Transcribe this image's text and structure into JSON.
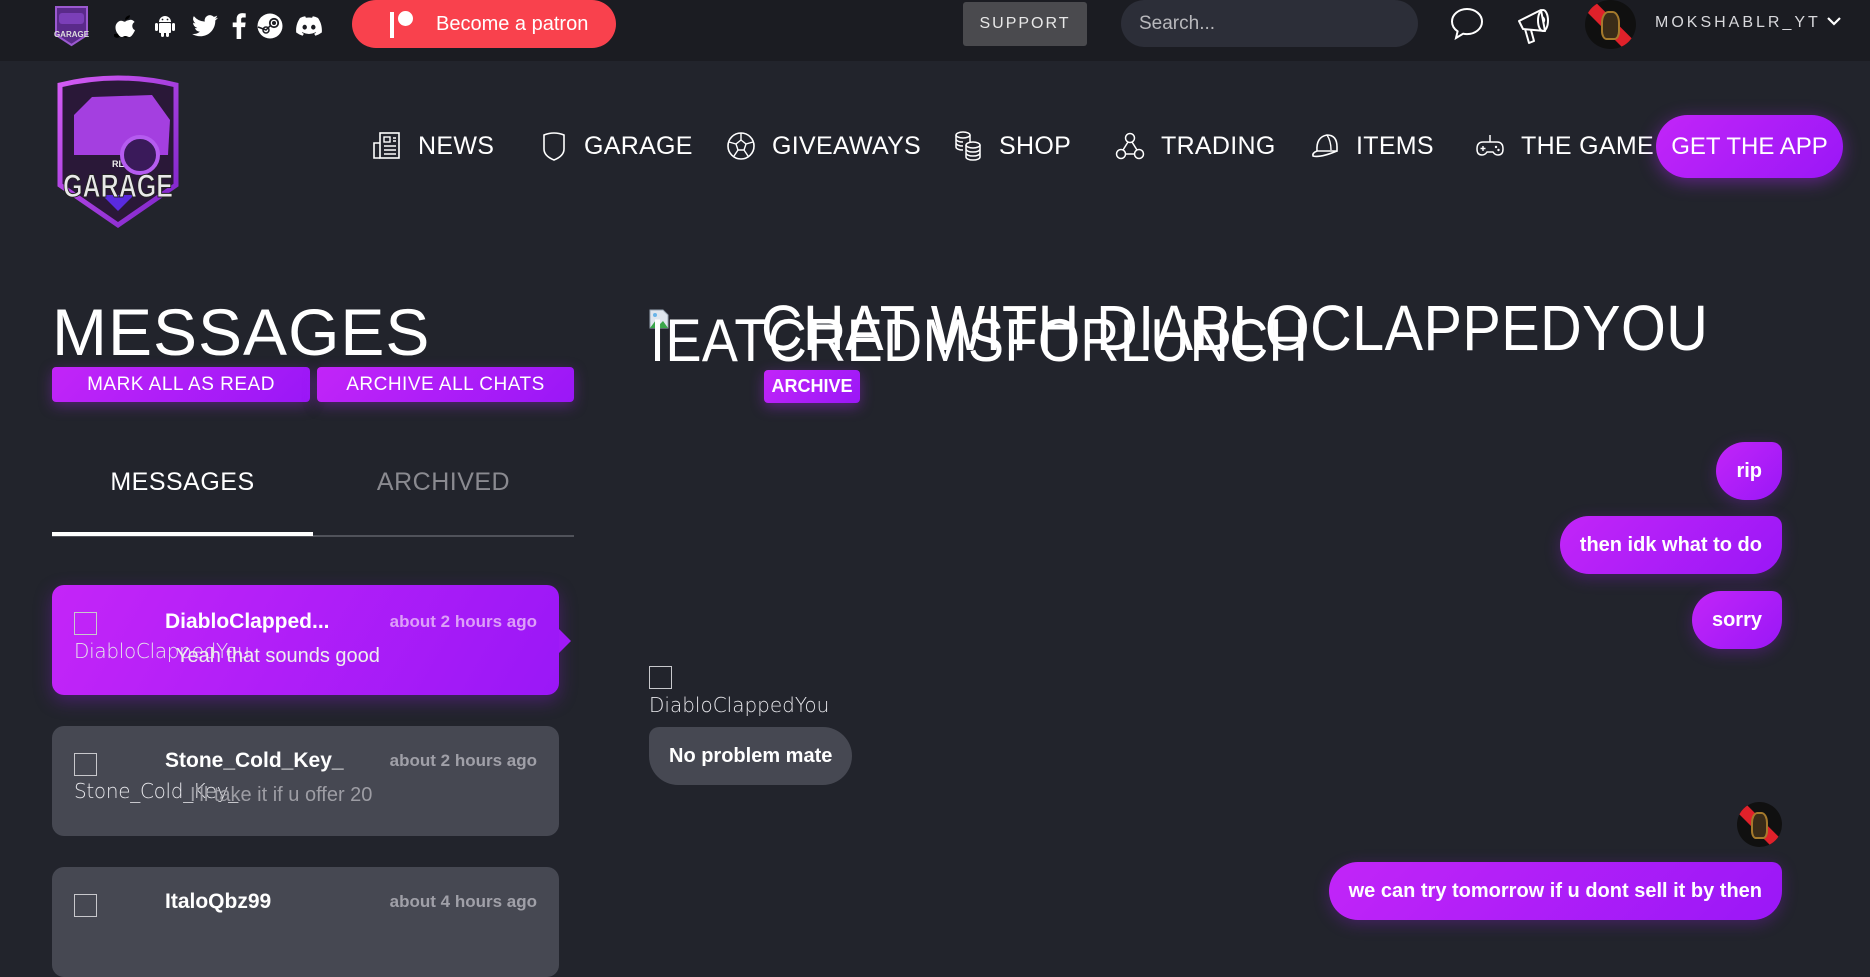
{
  "topbar": {
    "social_icons": [
      "apple-icon",
      "android-icon",
      "twitter-icon",
      "facebook-icon",
      "steam-icon",
      "discord-icon"
    ],
    "patreon_label": "Become a patron",
    "support_label": "SUPPORT",
    "search_placeholder": "Search...",
    "username": "MOKSHABLR_YT",
    "chevron": "⌄"
  },
  "nav": {
    "items": [
      {
        "label": "NEWS",
        "icon": "newspaper-icon"
      },
      {
        "label": "GARAGE",
        "icon": "shield-icon"
      },
      {
        "label": "GIVEAWAYS",
        "icon": "ball-icon"
      },
      {
        "label": "SHOP",
        "icon": "coins-icon"
      },
      {
        "label": "TRADING",
        "icon": "nodes-icon"
      },
      {
        "label": "ITEMS",
        "icon": "cap-icon"
      },
      {
        "label": "THE GAME",
        "icon": "gamepad-icon"
      }
    ],
    "get_app_label": "GET THE APP"
  },
  "messages": {
    "title": "MESSAGES",
    "mark_all_read": "MARK ALL AS READ",
    "archive_all": "ARCHIVE ALL CHATS",
    "tabs": [
      {
        "label": "MESSAGES",
        "active": true
      },
      {
        "label": "ARCHIVED",
        "active": false
      }
    ],
    "conversations": [
      {
        "alt": "DiabloClappedYou",
        "name": "DiabloClapped...",
        "time": "about 2 hours ago",
        "preview": "Yeah that sounds good",
        "active": true
      },
      {
        "alt": "Stone_Cold_Key_",
        "name": "Stone_Cold_Key_",
        "time": "about 2 hours ago",
        "preview": "I'll take it if u offer 20",
        "active": false
      },
      {
        "alt": "",
        "name": "ItaloQbz99",
        "time": "about 4 hours ago",
        "preview": "",
        "active": false
      }
    ]
  },
  "chat": {
    "image_alt": "IEATCREDMSFORLUNCH",
    "title": "CHAT WITH DIABLOCLAPPEDYOU",
    "archive_label": "ARCHIVE",
    "partner_name": "DiabloClappedYou",
    "messages": [
      {
        "from": "me",
        "text": "rip"
      },
      {
        "from": "me",
        "text": "then idk what to do"
      },
      {
        "from": "me",
        "text": "sorry"
      },
      {
        "from": "them",
        "text": "No problem mate"
      },
      {
        "from": "me",
        "text": "we can try tomorrow if u dont sell it by then"
      }
    ]
  },
  "colors": {
    "accent_start": "#c225f8",
    "accent_end": "#9a17f7",
    "patreon": "#f9414d",
    "background": "#22242c",
    "topbar": "#1b1c22",
    "card": "#464852"
  }
}
